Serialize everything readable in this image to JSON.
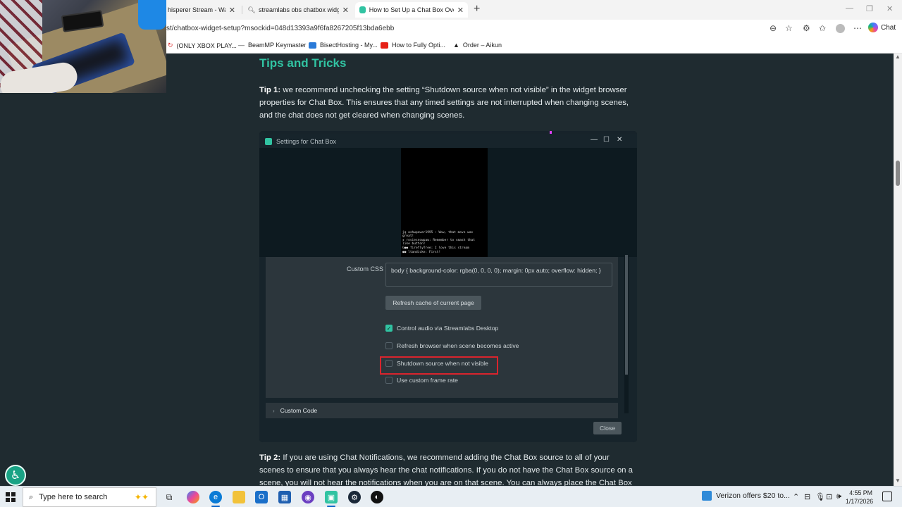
{
  "browser": {
    "tabs": [
      {
        "label": "hisperer Stream - Watch L",
        "icon": "twitch-icon",
        "active": false
      },
      {
        "label": "streamlabs obs chatbox widget ho",
        "icon": "search-icon",
        "active": false
      },
      {
        "label": "How to Set Up a Chat Box Overlay",
        "icon": "streamlabs-icon",
        "active": true
      }
    ],
    "new_tab": "+",
    "address": "st/chatbox-widget-setup?msockid=048d13393a9f6fa8267205f13bda6ebb",
    "chat_label": "Chat",
    "bookmarks": [
      {
        "label": "(ONLY XBOX PLAY...",
        "icon": "refresh-icon"
      },
      {
        "label": "BeamMP Keymaster",
        "icon": "dash-icon"
      },
      {
        "label": "BisectHosting - My...",
        "icon": "bisect-icon"
      },
      {
        "label": "How to Fully Opti...",
        "icon": "youtube-icon"
      },
      {
        "label": "Order – Aikun",
        "icon": "aikun-icon"
      }
    ]
  },
  "article": {
    "heading": "Tips and Tricks",
    "tip1_label": "Tip 1:",
    "tip1_text": " we recommend unchecking the setting “Shutdown source when not visible” in the widget browser properties for Chat Box. This ensures that any timed settings are not interrupted when changing scenes, and the chat does not get cleared when changing scenes.",
    "tip2_label": "Tip 2:",
    "tip2_text": " If you are using Chat Notifications, we recommend adding the Chat Box source to all of your scenes to ensure that you always hear the chat notifications. If you do not have the Chat Box source on a scene, you will not hear the notifications when you are on that scene. You can always place the Chat Box below"
  },
  "dialog": {
    "title": "Settings for Chat Box",
    "controls": {
      "minimize": "—",
      "maximize": "☐",
      "close": "✕"
    },
    "preview_lines": [
      "jq ashwpower1995 : Wow, that move was",
      "                    great!",
      "★ rosiesnowpaw: Remember to smash that",
      "                  like button!",
      "G●● fireflyTree: I love this stream",
      "●● ltandicke: First!"
    ],
    "custom_css_label": "Custom CSS",
    "custom_css_value": "body { background-color: rgba(0, 0, 0, 0); margin: 0px auto; overflow: hidden; }",
    "refresh_button": "Refresh cache of current page",
    "checkboxes": [
      {
        "label": "Control audio via Streamlabs Desktop",
        "checked": true
      },
      {
        "label": "Refresh browser when scene becomes active",
        "checked": false
      },
      {
        "label": "Shutdown source when not visible",
        "checked": false,
        "highlighted": true
      },
      {
        "label": "Use custom frame rate",
        "checked": false
      }
    ],
    "custom_code": "Custom Code",
    "close_button": "Close"
  },
  "taskbar": {
    "search_placeholder": "Type here to search",
    "news": "Verizon offers $20 to...",
    "time": "4:55 PM",
    "date": "1/17/2026"
  },
  "colors": {
    "page_bg": "#1f2b30",
    "accent": "#31c3a2",
    "highlight": "#d9242d"
  }
}
